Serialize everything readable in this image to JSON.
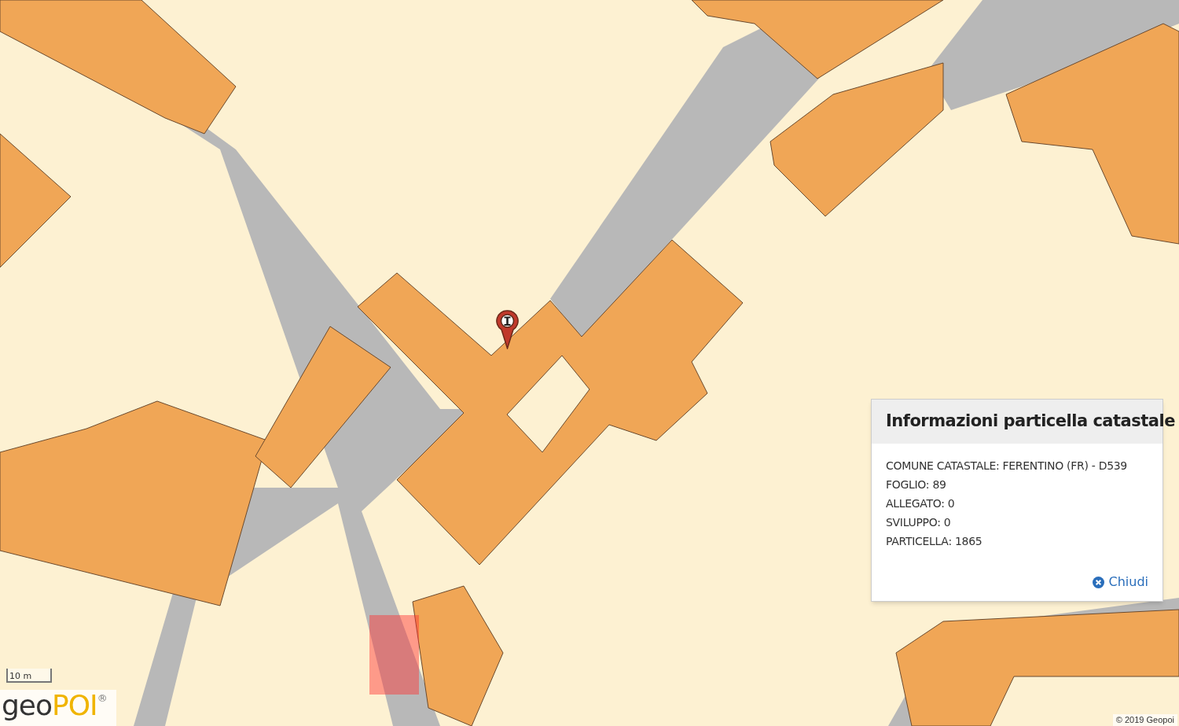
{
  "popup": {
    "title": "Informazioni particella catastale",
    "lines": [
      "COMUNE CATASTALE: FERENTINO (FR) - D539",
      "FOGLIO: 89",
      "ALLEGATO: 0",
      "SVILUPPO: 0",
      "PARTICELLA: 1865"
    ],
    "close_label": "Chiudi"
  },
  "scale": {
    "label": "10 m"
  },
  "logo": {
    "first": "geo",
    "second": "POI",
    "mark": "®"
  },
  "attribution": "© 2019 Geopoi"
}
